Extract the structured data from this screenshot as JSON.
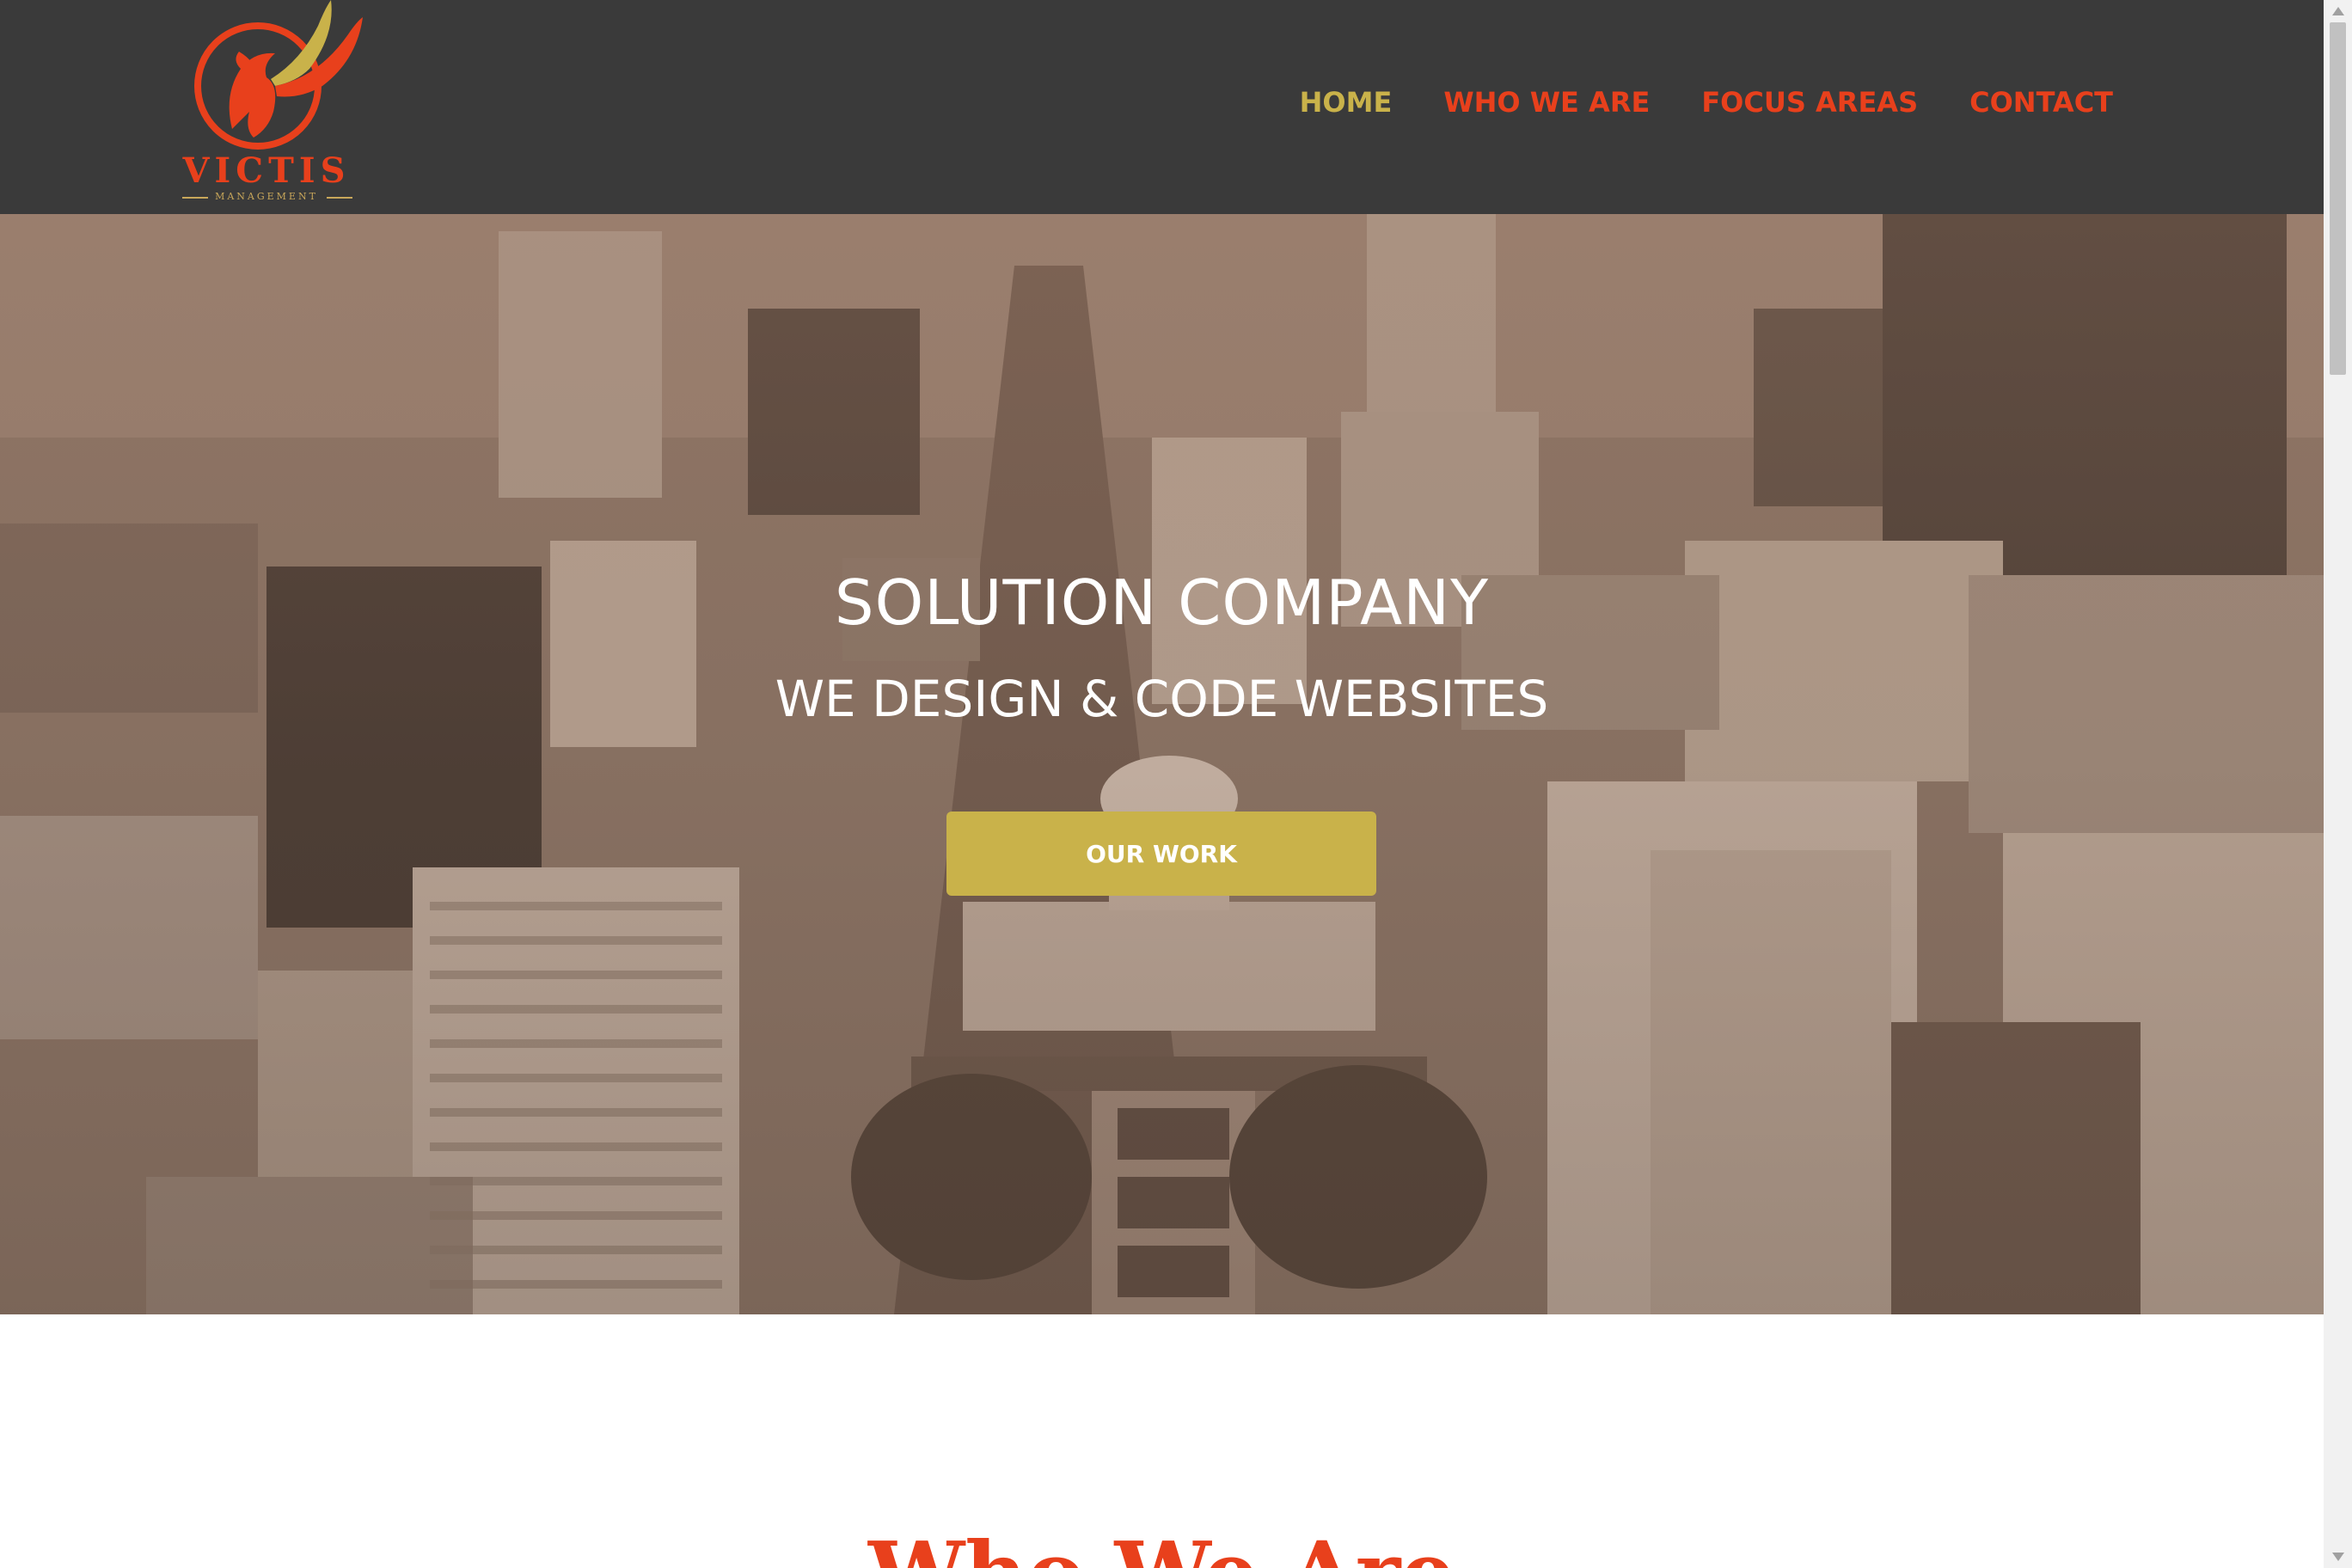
{
  "brand": {
    "name": "VICTIS",
    "tagline": "MANAGEMENT",
    "colors": {
      "primary": "#e8401c",
      "gold": "#c9b24a",
      "header_bg": "#3a3a3a"
    }
  },
  "nav": {
    "items": [
      {
        "label": "HOME",
        "active": true
      },
      {
        "label": "WHO WE ARE",
        "active": false
      },
      {
        "label": "FOCUS AREAS",
        "active": false
      },
      {
        "label": "CONTACT",
        "active": false
      }
    ]
  },
  "hero": {
    "title": "SOLUTION COMPANY",
    "subtitle": "WE DESIGN & CODE WEBSITES",
    "button_label": "OUR WORK"
  },
  "section": {
    "heading": "Who We Are"
  },
  "icons": [
    "pegasus-logo-icon",
    "scroll-up-icon",
    "scroll-down-icon"
  ]
}
